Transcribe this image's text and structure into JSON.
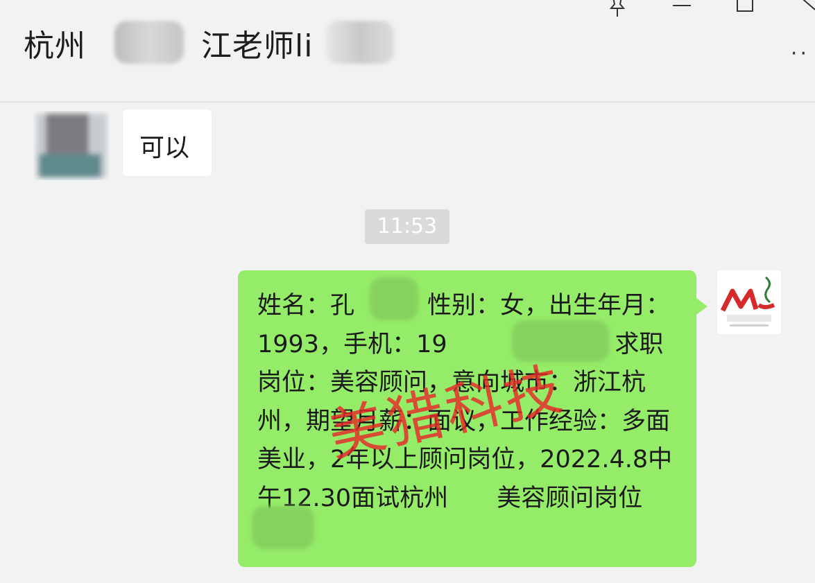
{
  "header": {
    "title_city": "杭州",
    "title_name": "江老师li",
    "more_label": "··"
  },
  "messages": {
    "incoming_text": "可以",
    "timestamp": "11:53",
    "outgoing_text": "姓名：孔　　，性别：女，出生年月：1993，手机：19　　　　612，求职岗位：美容顾问，意向城市：浙江杭州，期望月薪：面议，工作经验：多面美业，2年以上顾问岗位，2022.4.8中午12.30面试杭州　　美容顾问岗位"
  },
  "watermark": {
    "text": "美猎科技",
    "color": "#e62828"
  },
  "logo": {
    "mark": "ML",
    "brand_color": "#d42a2a"
  },
  "colors": {
    "outgoing_bubble": "#95ec69",
    "incoming_bubble": "#ffffff",
    "background": "#f2f2f2"
  }
}
